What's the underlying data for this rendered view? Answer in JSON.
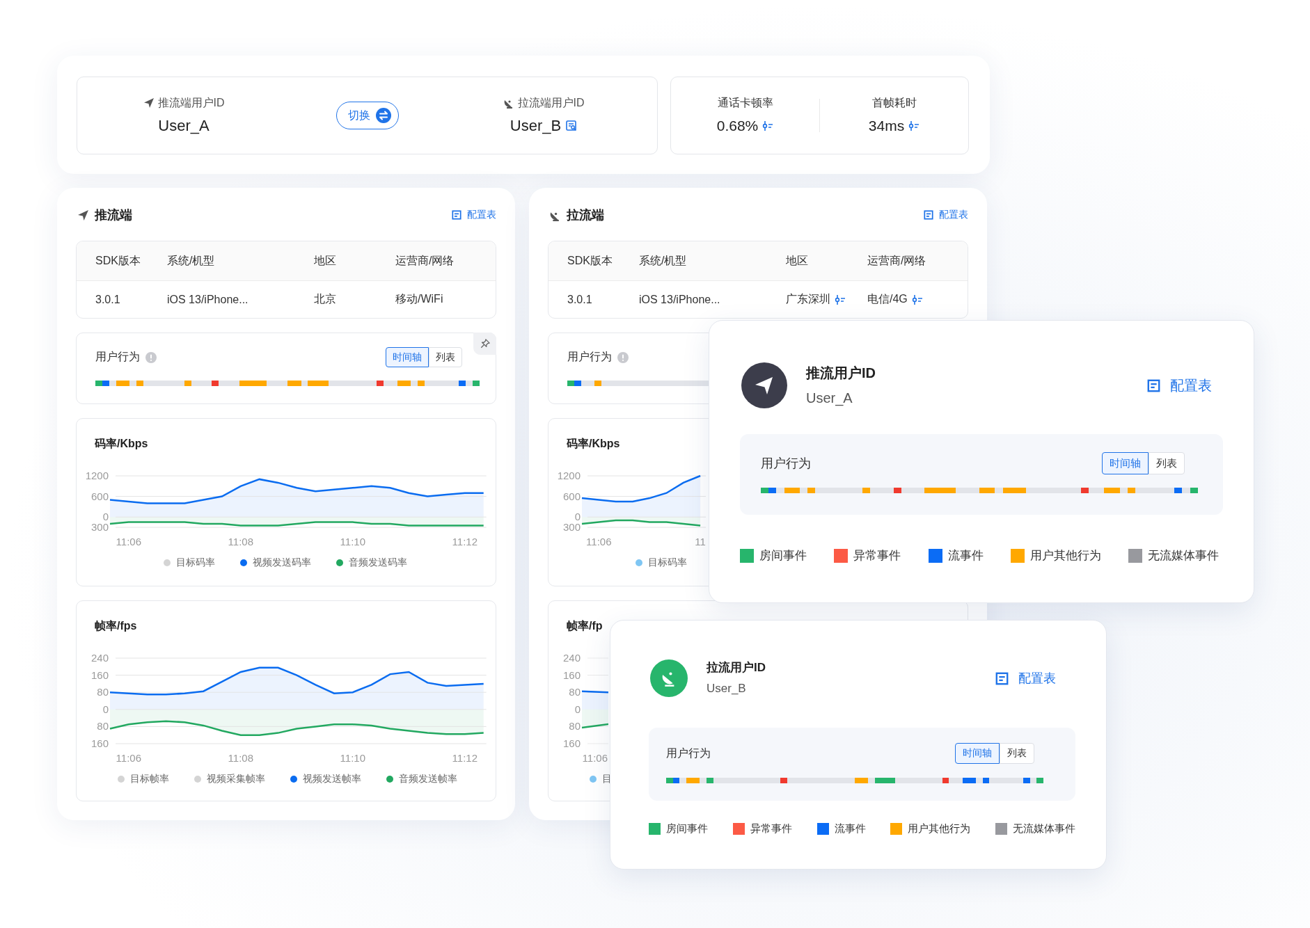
{
  "summary": {
    "push_user": {
      "label": "推流端用户ID",
      "value": "User_A"
    },
    "switch_button": {
      "label": "切换"
    },
    "pull_user": {
      "label": "拉流端用户ID",
      "value": "User_B"
    },
    "metrics": [
      {
        "label": "通话卡顿率",
        "value": "0.68%"
      },
      {
        "label": "首帧耗时",
        "value": "34ms"
      }
    ]
  },
  "panels": [
    {
      "kind": "push",
      "title": "推流端",
      "config_link": "配置表",
      "table": {
        "columns": [
          "SDK版本",
          "系统/机型",
          "地区",
          "运营商/网络"
        ],
        "row": [
          {
            "text": "3.0.1",
            "detail": false
          },
          {
            "text": "iOS 13/iPhone...",
            "detail": false
          },
          {
            "text": "北京",
            "detail": false
          },
          {
            "text": "移动/WiFi",
            "detail": false
          }
        ]
      },
      "behavior": {
        "title": "用户行为",
        "toggle": [
          {
            "label": "时间轴",
            "selected": true
          },
          {
            "label": "列表",
            "selected": false
          }
        ],
        "timeline": [
          {
            "kind": "room"
          },
          {
            "kind": "stream"
          },
          {
            "kind": "none"
          },
          {
            "kind": "other"
          },
          {
            "kind": "other"
          },
          {
            "kind": "none"
          },
          {
            "kind": "other"
          },
          {
            "kind": "none"
          },
          {
            "kind": "none"
          },
          {
            "kind": "none"
          },
          {
            "kind": "none"
          },
          {
            "kind": "none"
          },
          {
            "kind": "none"
          },
          {
            "kind": "other"
          },
          {
            "kind": "none"
          },
          {
            "kind": "none"
          },
          {
            "kind": "none"
          },
          {
            "kind": "error"
          },
          {
            "kind": "none"
          },
          {
            "kind": "none"
          },
          {
            "kind": "none"
          },
          {
            "kind": "other"
          },
          {
            "kind": "other"
          },
          {
            "kind": "other"
          },
          {
            "kind": "other"
          },
          {
            "kind": "none"
          },
          {
            "kind": "none"
          },
          {
            "kind": "none"
          },
          {
            "kind": "other"
          },
          {
            "kind": "other"
          },
          {
            "kind": "none"
          },
          {
            "kind": "other"
          },
          {
            "kind": "other"
          },
          {
            "kind": "other"
          },
          {
            "kind": "none"
          },
          {
            "kind": "none"
          },
          {
            "kind": "none"
          },
          {
            "kind": "none"
          },
          {
            "kind": "none"
          },
          {
            "kind": "none"
          },
          {
            "kind": "none"
          },
          {
            "kind": "error"
          },
          {
            "kind": "none"
          },
          {
            "kind": "none"
          },
          {
            "kind": "other"
          },
          {
            "kind": "other"
          },
          {
            "kind": "none"
          },
          {
            "kind": "other"
          },
          {
            "kind": "none"
          },
          {
            "kind": "none"
          },
          {
            "kind": "none"
          },
          {
            "kind": "none"
          },
          {
            "kind": "none"
          },
          {
            "kind": "stream"
          },
          {
            "kind": "none"
          },
          {
            "kind": "room"
          }
        ]
      },
      "charts": [
        {
          "title": "码率/Kbps",
          "chart_data": {
            "type": "area",
            "grid": true,
            "categories": [
              null,
              "11:06",
              null,
              null,
              null,
              null,
              null,
              "11:08",
              null,
              null,
              null,
              null,
              null,
              "11:10",
              null,
              null,
              null,
              null,
              null,
              "11:12",
              null
            ],
            "ylim": [
              -300,
              1200
            ],
            "yticks": [
              1200,
              600,
              0,
              {
                "value": -300,
                "label": "300"
              }
            ],
            "series": [
              {
                "name": "目标码率",
                "color": "#d4d4d4",
                "values": [
                  null,
                  null,
                  null,
                  null,
                  null,
                  null,
                  null,
                  null,
                  null,
                  null,
                  null,
                  null,
                  null,
                  null,
                  null,
                  null,
                  null,
                  null,
                  null,
                  null,
                  null
                ]
              },
              {
                "name": "视频发送码率",
                "color": "#0a6cf0",
                "values": [
                  500,
                  450,
                  400,
                  400,
                  400,
                  500,
                  600,
                  900,
                  1100,
                  1000,
                  850,
                  750,
                  800,
                  850,
                  900,
                  850,
                  700,
                  600,
                  650,
                  700,
                  700
                ]
              },
              {
                "name": "音频发送码率",
                "color": "#22a860",
                "values": [
                  -200,
                  -150,
                  -150,
                  -150,
                  -150,
                  -200,
                  -200,
                  -250,
                  -250,
                  -250,
                  -200,
                  -150,
                  -150,
                  -150,
                  -200,
                  -200,
                  -250,
                  -250,
                  -250,
                  -250,
                  -250
                ]
              }
            ]
          }
        },
        {
          "title": "帧率/fps",
          "chart_data": {
            "type": "area",
            "grid": true,
            "categories": [
              null,
              "11:06",
              null,
              null,
              null,
              null,
              null,
              "11:08",
              null,
              null,
              null,
              null,
              null,
              "11:10",
              null,
              null,
              null,
              null,
              null,
              "11:12",
              null
            ],
            "ylim": [
              -160,
              240
            ],
            "yticks": [
              240,
              160,
              80,
              0,
              {
                "value": -80,
                "label": "80"
              },
              {
                "value": -160,
                "label": "160"
              }
            ],
            "series": [
              {
                "name": "目标帧率",
                "color": "#d4d4d4",
                "values": [
                  null,
                  null,
                  null,
                  null,
                  null,
                  null,
                  null,
                  null,
                  null,
                  null,
                  null,
                  null,
                  null,
                  null,
                  null,
                  null,
                  null,
                  null,
                  null,
                  null,
                  null
                ]
              },
              {
                "name": "视频采集帧率",
                "color": "#d4d4d4",
                "values": [
                  null,
                  null,
                  null,
                  null,
                  null,
                  null,
                  null,
                  null,
                  null,
                  null,
                  null,
                  null,
                  null,
                  null,
                  null,
                  null,
                  null,
                  null,
                  null,
                  null,
                  null
                ]
              },
              {
                "name": "视频发送帧率",
                "color": "#0a6cf0",
                "values": [
                  80,
                  75,
                  70,
                  70,
                  75,
                  85,
                  130,
                  175,
                  195,
                  195,
                  160,
                  115,
                  75,
                  80,
                  115,
                  165,
                  175,
                  125,
                  110,
                  115,
                  120
                ]
              },
              {
                "name": "音频发送帧率",
                "color": "#22a860",
                "values": [
                  -90,
                  -70,
                  -60,
                  -55,
                  -60,
                  -75,
                  -100,
                  -120,
                  -120,
                  -110,
                  -90,
                  -80,
                  -70,
                  -70,
                  -75,
                  -90,
                  -100,
                  -110,
                  -115,
                  -115,
                  -110
                ]
              }
            ]
          }
        }
      ]
    },
    {
      "kind": "pull",
      "title": "拉流端",
      "config_link": "配置表",
      "table": {
        "columns": [
          "SDK版本",
          "系统/机型",
          "地区",
          "运营商/网络"
        ],
        "row": [
          {
            "text": "3.0.1",
            "detail": false
          },
          {
            "text": "iOS 13/iPhone...",
            "detail": false
          },
          {
            "text": "广东深圳",
            "detail": true
          },
          {
            "text": "电信/4G",
            "detail": true
          }
        ]
      },
      "behavior": {
        "title": "用户行为",
        "timeline": [
          {
            "kind": "room"
          },
          {
            "kind": "stream"
          },
          {
            "kind": "none"
          },
          {
            "kind": "none"
          },
          {
            "kind": "other"
          },
          {
            "kind": "none"
          },
          {
            "kind": "none"
          },
          {
            "kind": "none"
          },
          {
            "kind": "none"
          },
          {
            "kind": "none"
          },
          {
            "kind": "none"
          },
          {
            "kind": "none"
          },
          {
            "kind": "none"
          },
          {
            "kind": "none"
          },
          {
            "kind": "none"
          },
          {
            "kind": "none"
          },
          {
            "kind": "none"
          },
          {
            "kind": "none"
          },
          {
            "kind": "none"
          },
          {
            "kind": "none"
          },
          {
            "kind": "none"
          }
        ]
      },
      "charts": [
        {
          "title": "码率/Kbps",
          "chart_data": {
            "type": "area",
            "grid": true,
            "categories": [
              null,
              "11:06",
              null,
              null,
              null,
              null,
              null,
              "11"
            ],
            "ylim": [
              -300,
              1200
            ],
            "yticks": [
              1200,
              600,
              0,
              {
                "value": -300,
                "label": "300"
              }
            ],
            "series": [
              {
                "name": "目标码率",
                "color": "#7fc6f3",
                "values": [
                  null,
                  null,
                  null,
                  null,
                  null,
                  null,
                  null,
                  null
                ]
              },
              {
                "color": "#0a6cf0",
                "values": [
                  550,
                  500,
                  450,
                  450,
                  550,
                  700,
                  1000,
                  1200
                ]
              },
              {
                "color": "#22a860",
                "values": [
                  -200,
                  -150,
                  -100,
                  -100,
                  -150,
                  -150,
                  -200,
                  -250
                ]
              }
            ]
          }
        },
        {
          "title": "帧率/fp",
          "axis_labels": [
            "240",
            "160",
            "80",
            "0",
            "80",
            "160"
          ],
          "time_label": "11:06",
          "legend": [
            {
              "label": "目",
              "color": "#7fc6f3"
            }
          ]
        }
      ]
    }
  ],
  "popovers": [
    {
      "kind": "push",
      "title": "推流用户ID",
      "user": "User_A",
      "config_link": "配置表",
      "behavior": {
        "title": "用户行为",
        "toggle": [
          {
            "label": "时间轴",
            "selected": true
          },
          {
            "label": "列表",
            "selected": false
          }
        ],
        "timeline": [
          {
            "kind": "room"
          },
          {
            "kind": "stream"
          },
          {
            "kind": "none"
          },
          {
            "kind": "other"
          },
          {
            "kind": "other"
          },
          {
            "kind": "none"
          },
          {
            "kind": "other"
          },
          {
            "kind": "none"
          },
          {
            "kind": "none"
          },
          {
            "kind": "none"
          },
          {
            "kind": "none"
          },
          {
            "kind": "none"
          },
          {
            "kind": "none"
          },
          {
            "kind": "other"
          },
          {
            "kind": "none"
          },
          {
            "kind": "none"
          },
          {
            "kind": "none"
          },
          {
            "kind": "error"
          },
          {
            "kind": "none"
          },
          {
            "kind": "none"
          },
          {
            "kind": "none"
          },
          {
            "kind": "other"
          },
          {
            "kind": "other"
          },
          {
            "kind": "other"
          },
          {
            "kind": "other"
          },
          {
            "kind": "none"
          },
          {
            "kind": "none"
          },
          {
            "kind": "none"
          },
          {
            "kind": "other"
          },
          {
            "kind": "other"
          },
          {
            "kind": "none"
          },
          {
            "kind": "other"
          },
          {
            "kind": "other"
          },
          {
            "kind": "other"
          },
          {
            "kind": "none"
          },
          {
            "kind": "none"
          },
          {
            "kind": "none"
          },
          {
            "kind": "none"
          },
          {
            "kind": "none"
          },
          {
            "kind": "none"
          },
          {
            "kind": "none"
          },
          {
            "kind": "error"
          },
          {
            "kind": "none"
          },
          {
            "kind": "none"
          },
          {
            "kind": "other"
          },
          {
            "kind": "other"
          },
          {
            "kind": "none"
          },
          {
            "kind": "other"
          },
          {
            "kind": "none"
          },
          {
            "kind": "none"
          },
          {
            "kind": "none"
          },
          {
            "kind": "none"
          },
          {
            "kind": "none"
          },
          {
            "kind": "stream"
          },
          {
            "kind": "none"
          },
          {
            "kind": "room"
          }
        ]
      },
      "legend": [
        {
          "label": "房间事件",
          "color": "#27b56c"
        },
        {
          "label": "异常事件",
          "color": "#fc5a45"
        },
        {
          "label": "流事件",
          "color": "#0b6cf5"
        },
        {
          "label": "用户其他行为",
          "color": "#ffa800"
        },
        {
          "label": "无流媒体事件",
          "color": "#98999e"
        }
      ]
    },
    {
      "kind": "pull",
      "title": "拉流用户ID",
      "user": "User_B",
      "config_link": "配置表",
      "behavior": {
        "title": "用户行为",
        "toggle": [
          {
            "label": "时间轴",
            "selected": true
          },
          {
            "label": "列表",
            "selected": false
          }
        ],
        "timeline": [
          {
            "kind": "room"
          },
          {
            "kind": "stream"
          },
          {
            "kind": "none"
          },
          {
            "kind": "other"
          },
          {
            "kind": "other"
          },
          {
            "kind": "none"
          },
          {
            "kind": "room"
          },
          {
            "kind": "none"
          },
          {
            "kind": "none"
          },
          {
            "kind": "none"
          },
          {
            "kind": "none"
          },
          {
            "kind": "none"
          },
          {
            "kind": "none"
          },
          {
            "kind": "none"
          },
          {
            "kind": "none"
          },
          {
            "kind": "none"
          },
          {
            "kind": "none"
          },
          {
            "kind": "error"
          },
          {
            "kind": "none"
          },
          {
            "kind": "none"
          },
          {
            "kind": "none"
          },
          {
            "kind": "none"
          },
          {
            "kind": "none"
          },
          {
            "kind": "none"
          },
          {
            "kind": "none"
          },
          {
            "kind": "none"
          },
          {
            "kind": "none"
          },
          {
            "kind": "none"
          },
          {
            "kind": "other"
          },
          {
            "kind": "other"
          },
          {
            "kind": "none"
          },
          {
            "kind": "room"
          },
          {
            "kind": "room"
          },
          {
            "kind": "room"
          },
          {
            "kind": "none"
          },
          {
            "kind": "none"
          },
          {
            "kind": "none"
          },
          {
            "kind": "none"
          },
          {
            "kind": "none"
          },
          {
            "kind": "none"
          },
          {
            "kind": "none"
          },
          {
            "kind": "error"
          },
          {
            "kind": "none"
          },
          {
            "kind": "none"
          },
          {
            "kind": "stream"
          },
          {
            "kind": "stream"
          },
          {
            "kind": "none"
          },
          {
            "kind": "stream"
          },
          {
            "kind": "none"
          },
          {
            "kind": "none"
          },
          {
            "kind": "none"
          },
          {
            "kind": "none"
          },
          {
            "kind": "none"
          },
          {
            "kind": "stream"
          },
          {
            "kind": "none"
          },
          {
            "kind": "room"
          }
        ]
      },
      "legend": [
        {
          "label": "房间事件",
          "color": "#27b56c"
        },
        {
          "label": "异常事件",
          "color": "#fc5a45"
        },
        {
          "label": "流事件",
          "color": "#0b6cf5"
        },
        {
          "label": "用户其他行为",
          "color": "#ffa800"
        },
        {
          "label": "无流媒体事件",
          "color": "#98999e"
        }
      ]
    }
  ]
}
